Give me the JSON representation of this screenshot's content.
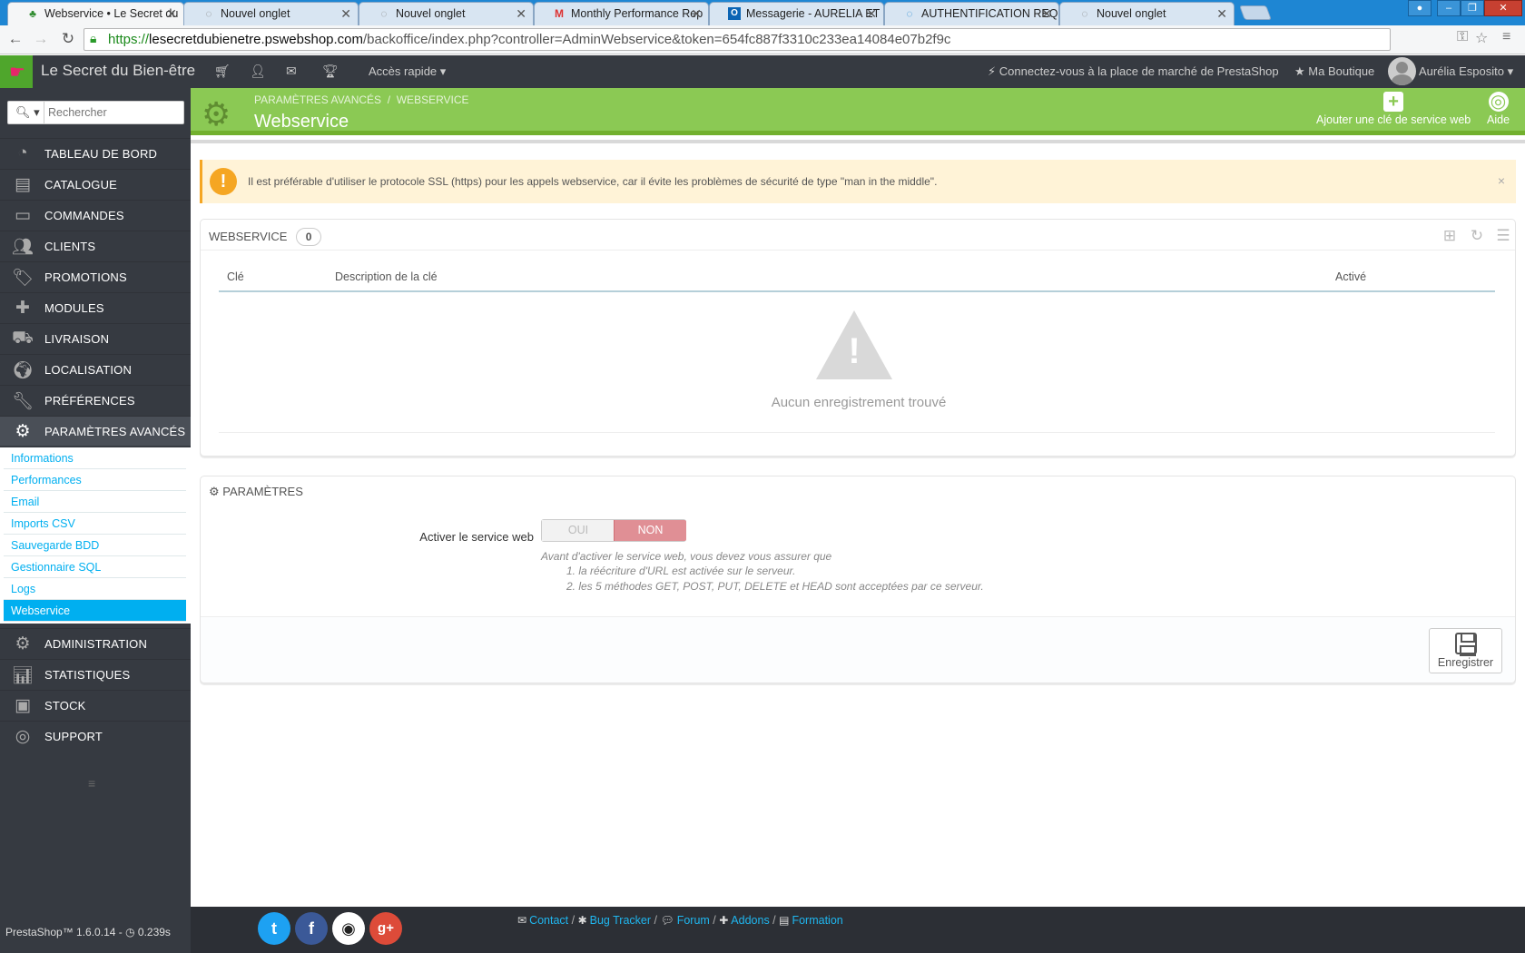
{
  "browser": {
    "tabs": [
      {
        "title": "Webservice • Le Secret du",
        "icon": "tree-favicon"
      },
      {
        "title": "Nouvel onglet",
        "icon": "spinner-favicon"
      },
      {
        "title": "Nouvel onglet",
        "icon": "spinner-favicon"
      },
      {
        "title": "Monthly Performance Rep",
        "icon": "gmail-favicon"
      },
      {
        "title": "Messagerie - AURELIA ET I",
        "icon": "outlook-favicon"
      },
      {
        "title": "AUTHENTIFICATION REQ",
        "icon": "spinner-favicon"
      },
      {
        "title": "Nouvel onglet",
        "icon": "spinner-favicon"
      }
    ],
    "url": {
      "scheme": "https://",
      "host": "lesecretdubienetre.pswebshop.com",
      "path": "/backoffice/index.php?controller=AdminWebservice&token=654fc887f3310c233ea14084e07b2f9c"
    }
  },
  "header": {
    "shop_name": "Le Secret du Bien-être",
    "quick_access": "Accès rapide",
    "marketplace_link": "Connectez-vous à la place de marché de PrestaShop",
    "my_shop": "Ma Boutique",
    "user_name": "Aurélia Esposito"
  },
  "sidebar": {
    "search_placeholder": "Rechercher",
    "items": [
      {
        "label": "Tableau de bord",
        "icon": "dashboard-icon"
      },
      {
        "label": "Catalogue",
        "icon": "book-icon"
      },
      {
        "label": "Commandes",
        "icon": "credit-card-icon"
      },
      {
        "label": "Clients",
        "icon": "users-icon"
      },
      {
        "label": "Promotions",
        "icon": "tags-icon"
      },
      {
        "label": "Modules",
        "icon": "puzzle-icon"
      },
      {
        "label": "Livraison",
        "icon": "truck-icon"
      },
      {
        "label": "Localisation",
        "icon": "globe-icon"
      },
      {
        "label": "Préférences",
        "icon": "wrench-icon"
      },
      {
        "label": "Paramètres avancés",
        "icon": "gears-icon"
      },
      {
        "label": "Administration",
        "icon": "gear-icon"
      },
      {
        "label": "Statistiques",
        "icon": "bar-chart-icon"
      },
      {
        "label": "Stock",
        "icon": "archive-icon"
      },
      {
        "label": "Support",
        "icon": "lifebuoy-icon"
      }
    ],
    "submenu": [
      "Informations",
      "Performances",
      "Email",
      "Imports CSV",
      "Sauvegarde BDD",
      "Gestionnaire SQL",
      "Logs",
      "Webservice"
    ]
  },
  "page": {
    "breadcrumb_parent": "Paramètres avancés",
    "breadcrumb_separator": "/",
    "breadcrumb_current": "Webservice",
    "title": "Webservice",
    "add_key_button": "Ajouter une clé de service web",
    "help_button": "Aide"
  },
  "alert": {
    "text": "Il est préférable d'utiliser le protocole SSL (https) pour les appels webservice, car il évite les problèmes de sécurité de type \"man in the middle\".",
    "close": "×"
  },
  "list_panel": {
    "title": "Webservice",
    "count": "0",
    "columns": [
      "Clé",
      "Description de la clé",
      "Activé"
    ],
    "empty_message": "Aucun enregistrement trouvé"
  },
  "settings_panel": {
    "title": "Paramètres",
    "field_label": "Activer le service web",
    "switch_yes": "OUI",
    "switch_no": "NON",
    "selected": "NON",
    "help_intro": "Avant d'activer le service web, vous devez vous assurer que",
    "help_items": [
      "1. la réécriture d'URL est activée sur le serveur.",
      "2. les 5 méthodes GET, POST, PUT, DELETE et HEAD sont acceptées par ce serveur."
    ],
    "save_button": "Enregistrer"
  },
  "footer": {
    "version": "PrestaShop™ 1.6.0.14 - ",
    "load_time": "0.239s",
    "social": [
      {
        "name": "twitter",
        "color": "#1da1f2"
      },
      {
        "name": "facebook",
        "color": "#3b5998"
      },
      {
        "name": "github",
        "color": "#222222"
      },
      {
        "name": "google-plus",
        "color": "#dd4b39"
      }
    ],
    "links": [
      "Contact",
      "Bug Tracker",
      "Forum",
      "Addons",
      "Formation"
    ]
  },
  "colors": {
    "header_dark": "#363a41",
    "page_head_green": "#8bc954",
    "link_blue": "#00aff0",
    "switch_no_red": "#e08f95",
    "alert_orange": "#f5a623"
  }
}
